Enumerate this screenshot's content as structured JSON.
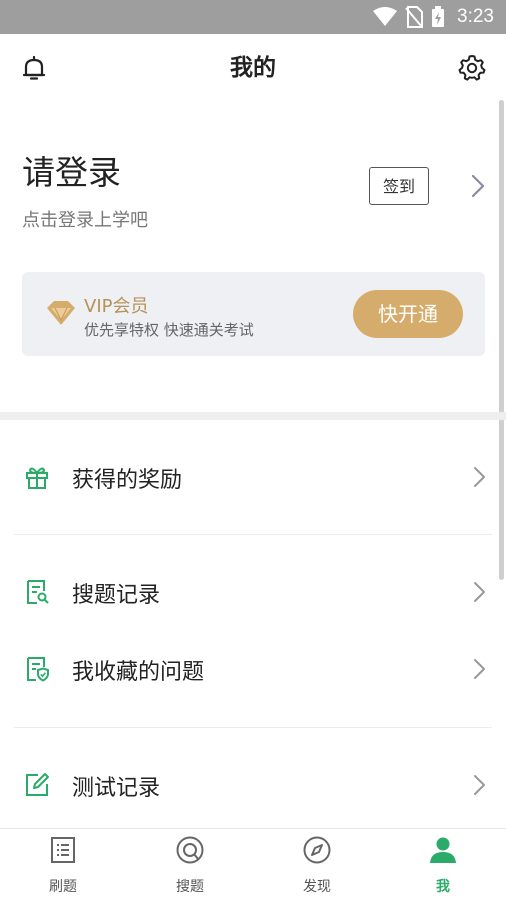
{
  "status_bar": {
    "time": "3:23"
  },
  "header": {
    "title": "我的"
  },
  "login": {
    "prompt": "请登录",
    "subtitle": "点击登录上学吧",
    "checkin_label": "签到"
  },
  "vip": {
    "title": "VIP会员",
    "subtitle": "优先享特权 快速通关考试",
    "button": "快开通"
  },
  "menu": {
    "rewards": "获得的奖励",
    "search_history": "搜题记录",
    "favorites": "我收藏的问题",
    "test_records": "测试记录"
  },
  "tabs": [
    {
      "label": "刷题",
      "icon": "list-icon"
    },
    {
      "label": "搜题",
      "icon": "search-icon"
    },
    {
      "label": "发现",
      "icon": "compass-icon"
    },
    {
      "label": "我",
      "icon": "user-icon"
    }
  ],
  "colors": {
    "accent_green": "#2bab69",
    "vip_gold": "#d6ac6d",
    "status_bar": "#9e9e9e"
  }
}
